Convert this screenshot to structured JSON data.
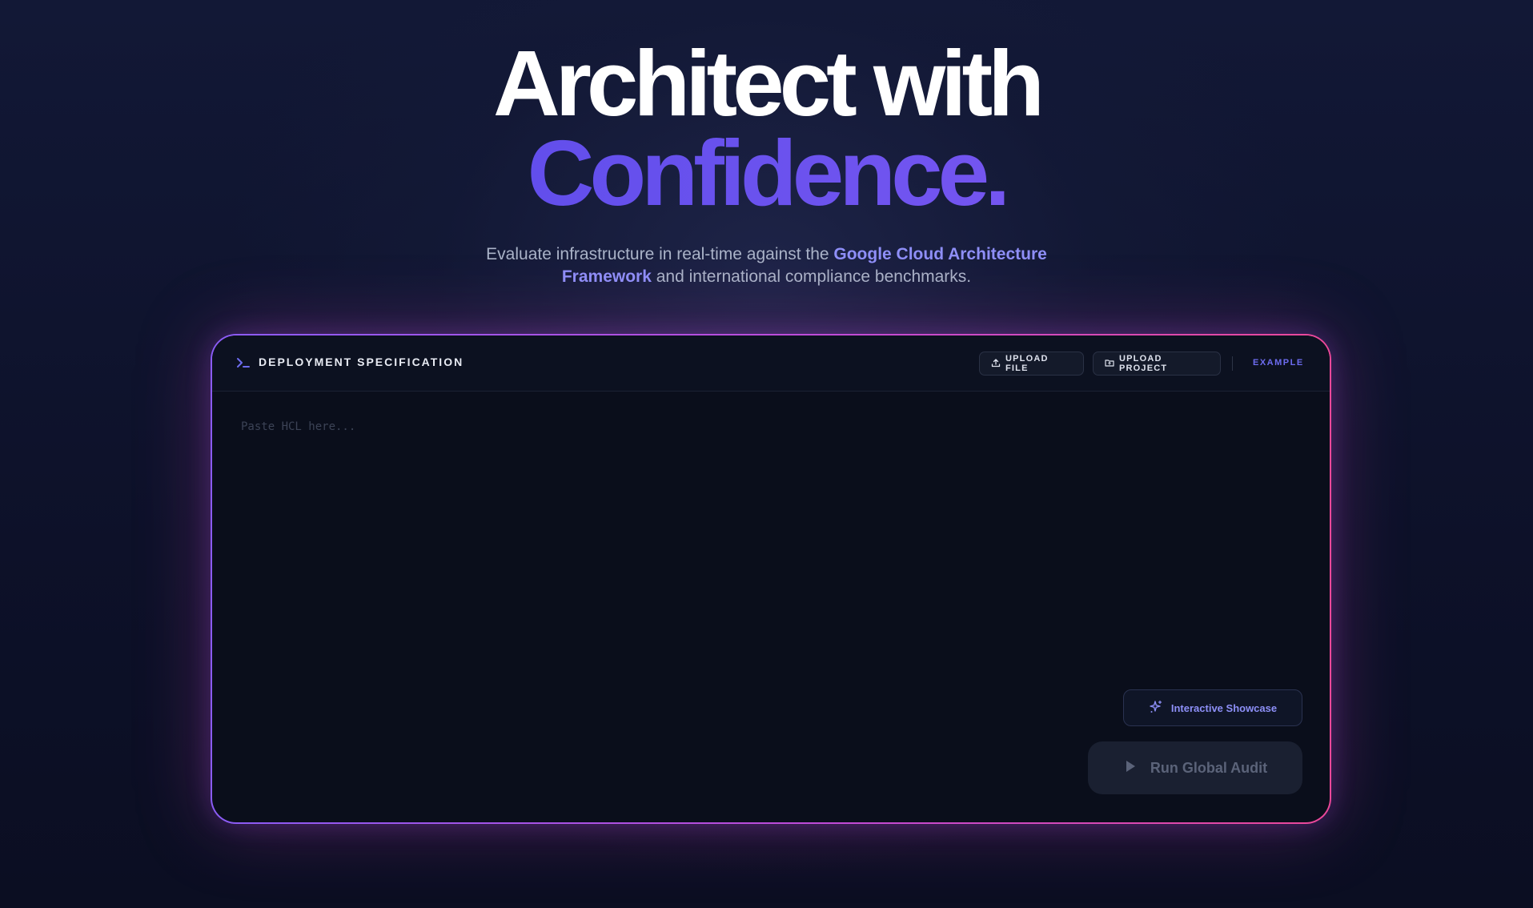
{
  "hero": {
    "line1": "Architect with",
    "line2": "Confidence."
  },
  "subtitle": {
    "before": "Evaluate infrastructure in real-time against the ",
    "highlight": "Google Cloud Architecture Framework",
    "after": " and international compliance benchmarks."
  },
  "panel": {
    "title": "DEPLOYMENT SPECIFICATION",
    "upload_file_label": "UPLOAD FILE",
    "upload_project_label": "UPLOAD PROJECT",
    "example_label": "EXAMPLE",
    "input_placeholder": "Paste HCL here...",
    "input_value": "",
    "showcase_label": "Interactive Showcase",
    "audit_label": "Run Global Audit"
  },
  "icons": {
    "terminal": "terminal-icon",
    "upload": "upload-icon",
    "folder": "folder-icon",
    "sparkles": "sparkles-icon",
    "play": "play-icon"
  },
  "colors": {
    "accent": "#8f8ff8",
    "gradient_start": "#8b5cf6",
    "gradient_end": "#ec4899",
    "panel_bg": "#0a0e1b"
  }
}
